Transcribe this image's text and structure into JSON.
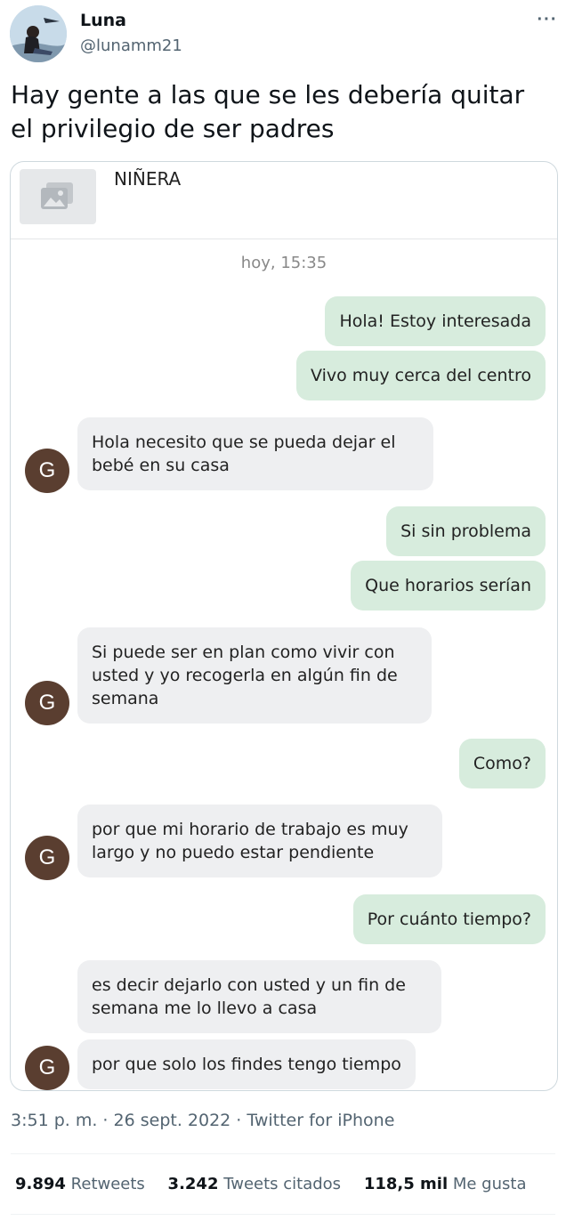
{
  "author": {
    "name": "Luna",
    "handle": "@lunamm21"
  },
  "tweet": {
    "text": "Hay gente a las que se les debería quitar el privilegio de ser padres"
  },
  "chat": {
    "contact_name": "NIÑERA",
    "timestamp": "hoy, 15:35",
    "avatar_letter": "G",
    "messages": [
      {
        "dir": "out",
        "text": "Hola! Estoy interesada"
      },
      {
        "dir": "out",
        "text": "Vivo muy cerca del centro"
      },
      {
        "dir": "in",
        "text": "Hola necesito que se pueda dejar el bebé en su casa"
      },
      {
        "dir": "out",
        "text": "Si sin problema"
      },
      {
        "dir": "out",
        "text": "Que horarios serían"
      },
      {
        "dir": "in",
        "text": "Si puede ser en plan como vivir con usted y yo recogerla en algún fin de semana"
      },
      {
        "dir": "out",
        "text": "Como?"
      },
      {
        "dir": "in",
        "text": "por que mi horario de trabajo es muy largo y no puedo estar pendiente"
      },
      {
        "dir": "out",
        "text": "Por cuánto tiempo?"
      },
      {
        "dir": "in",
        "text": "es decir dejarlo con usted y un fin de semana me lo llevo a casa"
      },
      {
        "dir": "in",
        "text": "por que solo los findes tengo tiempo"
      }
    ]
  },
  "meta": {
    "text": "3:51 p. m. · 26 sept. 2022 · Twitter for iPhone"
  },
  "stats": {
    "retweets_count": "9.894",
    "retweets_label": "Retweets",
    "quotes_count": "3.242",
    "quotes_label": "Tweets citados",
    "likes_count": "118,5 mil",
    "likes_label": "Me gusta"
  },
  "colors": {
    "outgoing_bubble": "#d7ecdd",
    "incoming_bubble": "#eeeff1",
    "avatar_g": "#5a3e30"
  },
  "icons": [
    "more-icon",
    "image-placeholder-icon"
  ]
}
